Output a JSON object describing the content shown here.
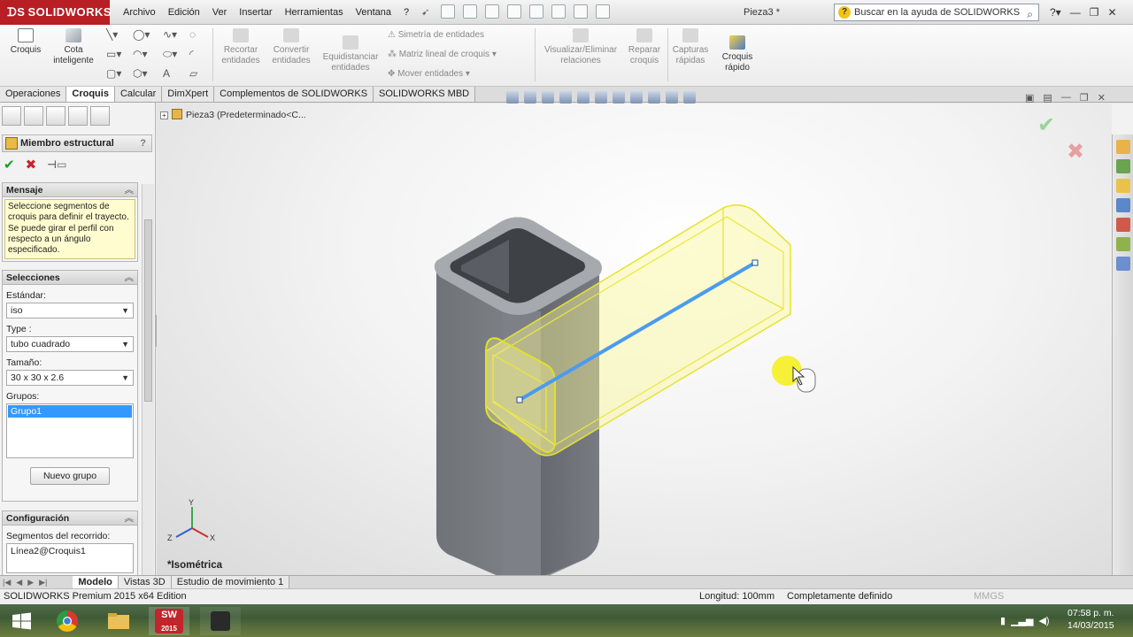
{
  "app": {
    "logo": "SOLIDWORKS",
    "doc_title": "Pieza3 *",
    "search_placeholder": "Buscar en la ayuda de SOLIDWORKS"
  },
  "menu": [
    "Archivo",
    "Edición",
    "Ver",
    "Insertar",
    "Herramientas",
    "Ventana",
    "?"
  ],
  "commands": {
    "croquis": "Croquis",
    "cota": "Cota inteligente",
    "recortar": "Recortar entidades",
    "convertir": "Convertir entidades",
    "equidistanciar": "Equidistanciar entidades",
    "simetria": "Simetría de entidades",
    "matriz": "Matriz lineal de croquis",
    "mover": "Mover entidades",
    "visualizar": "Visualizar/Eliminar relaciones",
    "reparar": "Reparar croquis",
    "capturas": "Capturas rápidas",
    "croquis_rapido": "Croquis rápido"
  },
  "tabs": [
    "Operaciones",
    "Croquis",
    "Calcular",
    "DimXpert",
    "Complementos de SOLIDWORKS",
    "SOLIDWORKS MBD"
  ],
  "active_tab": "Croquis",
  "tree": {
    "root": "Pieza3  (Predeterminado<C..."
  },
  "property_manager": {
    "title": "Miembro estructural",
    "help": "?",
    "mensaje": {
      "header": "Mensaje",
      "text": "Seleccione segmentos de croquis para definir el trayecto. Se puede girar el perfil con respecto a un ángulo especificado."
    },
    "selecciones": {
      "header": "Selecciones",
      "estandar_label": "Estándar:",
      "estandar_value": "iso",
      "type_label": "Type :",
      "type_value": "tubo cuadrado",
      "tamano_label": "Tamaño:",
      "tamano_value": "30 x 30 x 2.6",
      "grupos_label": "Grupos:",
      "grupos": [
        "Grupo1"
      ],
      "nuevo_grupo": "Nuevo grupo"
    },
    "configuracion": {
      "header": "Configuración",
      "segmentos_label": "Segmentos del recorrido:",
      "segmentos": [
        "Línea2@Croquis1"
      ]
    }
  },
  "viewport": {
    "view_label": "*Isométrica",
    "triad": {
      "y": "Y",
      "x": "X",
      "z": "Z"
    }
  },
  "bottom_tabs": [
    "Modelo",
    "Vistas 3D",
    "Estudio de movimiento 1"
  ],
  "status": {
    "edition": "SOLIDWORKS Premium 2015 x64 Edition",
    "longitud": "Longitud: 100mm",
    "definicion": "Completamente definido",
    "units": "MMGS"
  },
  "taskbar": {
    "time": "07:58 p. m.",
    "date": "14/03/2015",
    "sw_badge": "SW",
    "sw_year": "2015"
  },
  "colors": {
    "brand": "#b71f24",
    "highlight": "#3399ff",
    "preview": "#f0ec3c",
    "path": "#4a9bf0"
  }
}
